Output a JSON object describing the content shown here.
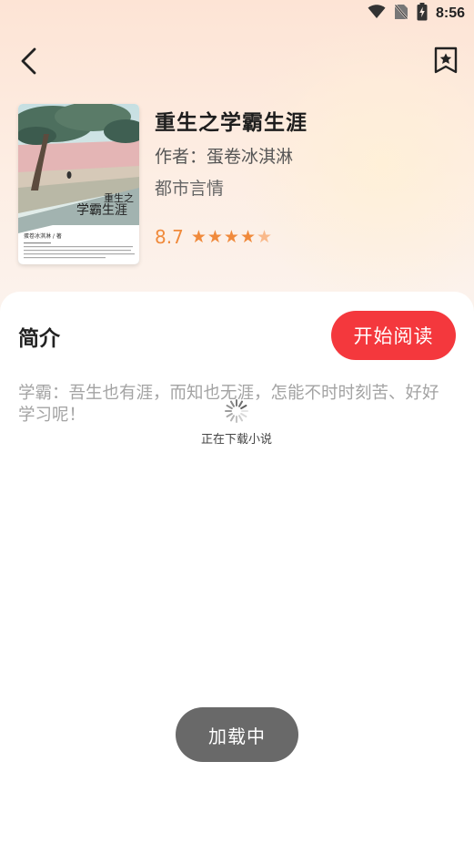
{
  "status_bar": {
    "time": "8:56",
    "icons": [
      "wifi-icon",
      "no-sim-icon",
      "battery-charging-icon"
    ]
  },
  "header": {
    "back_icon": "chevron-left-icon",
    "bookmark_icon": "bookmark-star-icon"
  },
  "book": {
    "title": "重生之学霸生涯",
    "author_label": "作者：",
    "author": "蛋卷冰淇淋",
    "category": "都市言情",
    "rating": "8.7",
    "rating_stars": 4.5,
    "cover": {
      "title": "重生之学霸生涯",
      "title_line1": "重生之",
      "title_line2": "学霸生涯",
      "author": "蛋卷冰淇淋 / 著"
    }
  },
  "intro": {
    "label": "简介",
    "read_button": "开始阅读",
    "text": "学霸：吾生也有涯，而知也无涯，怎能不时时刻苦、好好学习呢！"
  },
  "loader": {
    "text": "正在下载小说"
  },
  "toast": {
    "text": "加载中"
  },
  "colors": {
    "accent": "#f4383d",
    "rating": "#f08a3c",
    "toast_bg": "#696969"
  }
}
